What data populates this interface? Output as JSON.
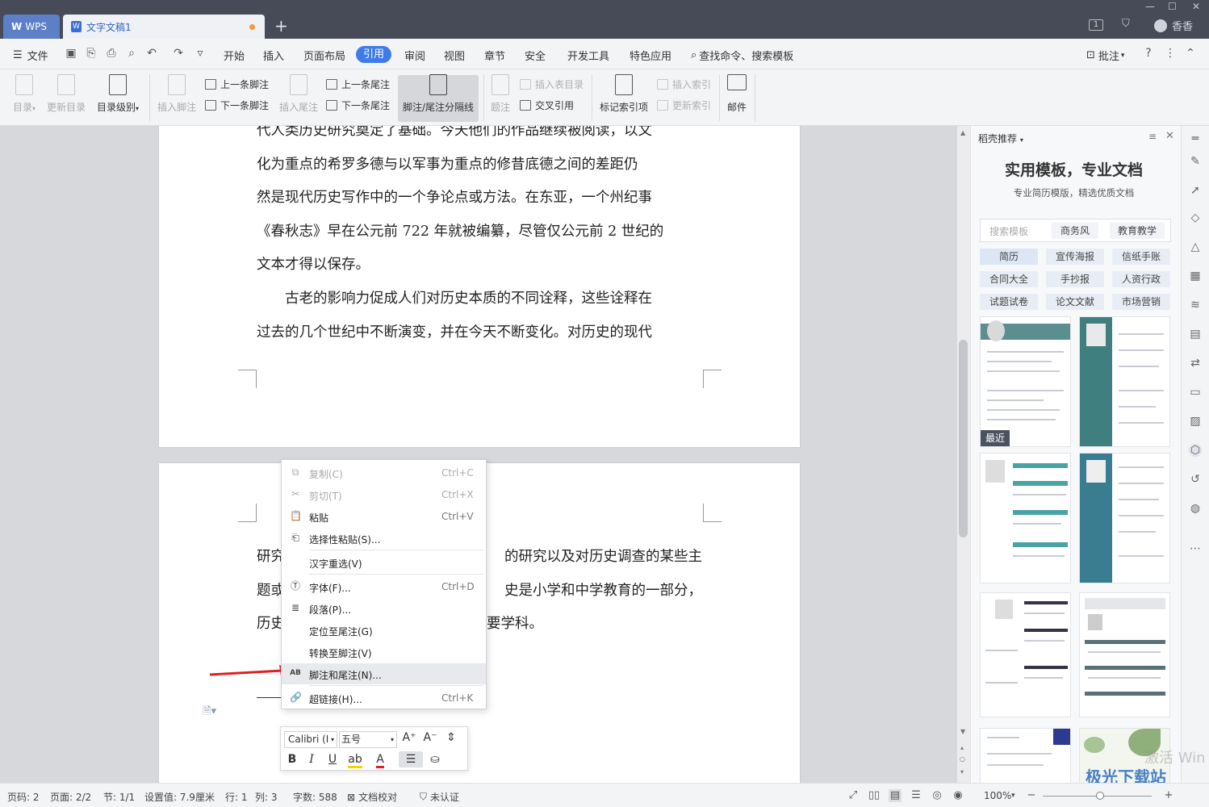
{
  "titlebar": {
    "wps_tab": "WPS",
    "doc_tab": "文字文稿1",
    "new_tab": "+",
    "page_count_badge": "1",
    "user_name": "香香"
  },
  "menubar": {
    "file": "文件",
    "items": [
      "开始",
      "插入",
      "页面布局",
      "引用",
      "审阅",
      "视图",
      "章节",
      "安全",
      "开发工具",
      "特色应用"
    ],
    "active": "引用",
    "search": "查找命令、搜索模板",
    "comment": "批注"
  },
  "ribbon": {
    "toc": "目录",
    "update_toc": "更新目录",
    "toc_level": "目录级别",
    "insert_footnote": "插入脚注",
    "prev_footnote": "上一条脚注",
    "next_footnote": "下一条脚注",
    "insert_endnote": "插入尾注",
    "prev_endnote": "上一条尾注",
    "next_endnote": "下一条尾注",
    "separator": "脚注/尾注分隔线",
    "caption": "题注",
    "insert_table_of_figures": "插入表目录",
    "cross_ref": "交叉引用",
    "mark_index": "标记索引项",
    "insert_index": "插入索引",
    "update_index": "更新索引",
    "mail": "邮件"
  },
  "document": {
    "page1_lines": [
      "代人类历史研究奠定了基础。今天他们的作品继续被阅读，以文",
      "化为重点的希罗多德与以军事为重点的修昔底德之间的差距仍",
      "然是现代历史写作中的一个争论点或方法。在东亚，一个州纪事",
      "《春秋志》早在公元前 722 年就被编纂，尽管仅公元前 2 世纪的",
      "文本才得以保存。",
      "　　古老的影响力促成人们对历史本质的不同诠释，这些诠释在",
      "过去的几个世纪中不断演变，并在今天不断变化。对历史的现代"
    ],
    "page2_fragments": [
      {
        "left": "研究",
        "right": "的研究以及对历史调查的某些主"
      },
      {
        "left": "题或",
        "right": "史是小学和中学教育的一部分，"
      },
      {
        "left": "历史",
        "right": "要学科。"
      }
    ]
  },
  "context_menu": {
    "items": [
      {
        "label": "复制(C)",
        "shortcut": "Ctrl+C",
        "icon": "copy-icon",
        "disabled": true
      },
      {
        "label": "剪切(T)",
        "shortcut": "Ctrl+X",
        "icon": "scissors-icon",
        "disabled": true
      },
      {
        "label": "粘贴",
        "shortcut": "Ctrl+V",
        "icon": "paste-icon",
        "disabled": false
      },
      {
        "label": "选择性粘贴(S)...",
        "shortcut": "",
        "icon": "paste-special-icon",
        "disabled": false
      },
      {
        "label": "汉字重选(V)",
        "shortcut": "",
        "icon": "",
        "disabled": false
      },
      {
        "label": "字体(F)...",
        "shortcut": "Ctrl+D",
        "icon": "font-icon",
        "disabled": false
      },
      {
        "label": "段落(P)...",
        "shortcut": "",
        "icon": "paragraph-icon",
        "disabled": false
      },
      {
        "label": "定位至尾注(G)",
        "shortcut": "",
        "icon": "",
        "disabled": false
      },
      {
        "label": "转换至脚注(V)",
        "shortcut": "",
        "icon": "",
        "disabled": false
      },
      {
        "label": "脚注和尾注(N)...",
        "shortcut": "",
        "icon": "footnote-icon",
        "disabled": false
      },
      {
        "label": "超链接(H)...",
        "shortcut": "Ctrl+K",
        "icon": "link-icon",
        "disabled": false
      }
    ],
    "highlighted": "脚注和尾注(N)..."
  },
  "mini_toolbar": {
    "font": "Calibri (I",
    "size": "五号"
  },
  "side_panel": {
    "header": "稻壳推荐",
    "title": "实用模板，专业文档",
    "subtitle": "专业简历模版，精选优质文档",
    "search_placeholder": "搜索模板",
    "search_tags": [
      "商务风",
      "教育教学"
    ],
    "categories": [
      "简历",
      "宣传海报",
      "信纸手账",
      "合同大全",
      "手抄报",
      "人资行政",
      "试题试卷",
      "论文文献",
      "市场营销"
    ],
    "recent_badge": "最近"
  },
  "statusbar": {
    "page_no": "页码: 2",
    "pages": "页面: 2/2",
    "section": "节: 1/1",
    "setting": "设置值: 7.9厘米",
    "row": "行: 1",
    "col": "列: 3",
    "words": "字数: 588",
    "proof": "文档校对",
    "auth": "未认证",
    "zoom": "100%"
  },
  "watermark": {
    "site": "极光下载站",
    "partial": "激活 Win"
  },
  "colors": {
    "accent": "#3d7be8",
    "titlebar": "#474b57",
    "arrow": "#e02020",
    "template_teal": "#3f8a8a"
  }
}
